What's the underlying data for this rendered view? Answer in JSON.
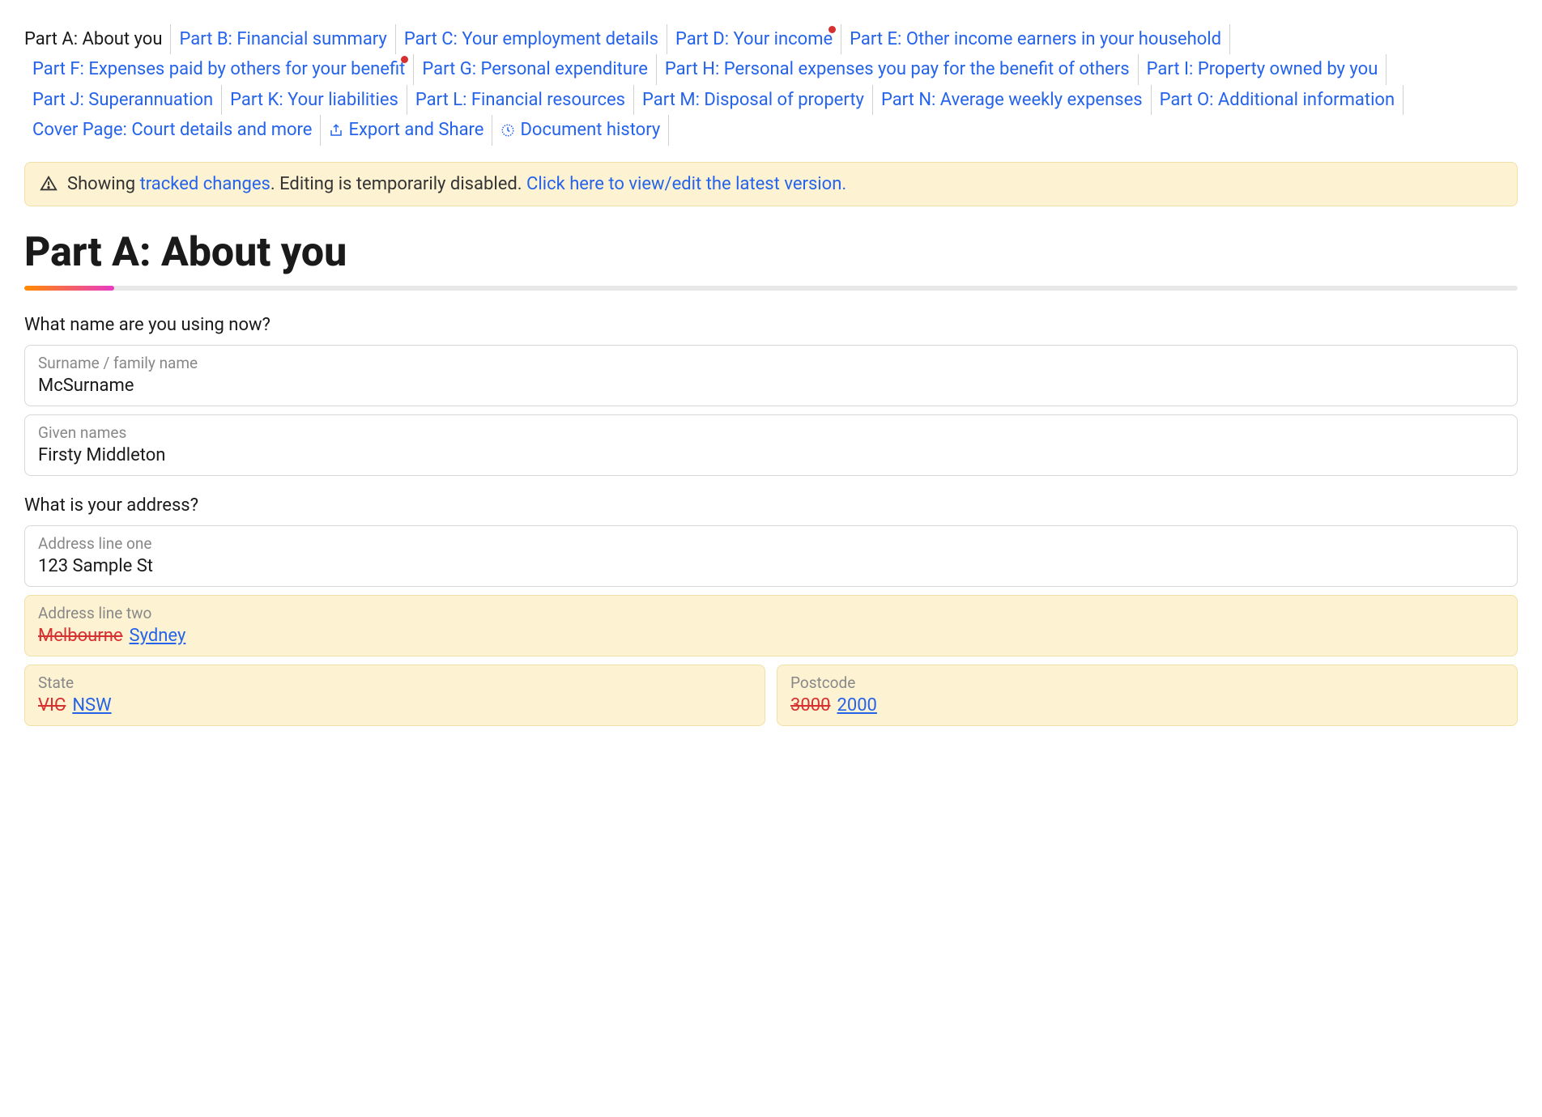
{
  "nav": [
    {
      "label": "Part A: About you",
      "active": true,
      "dot": false
    },
    {
      "label": "Part B: Financial summary",
      "active": false,
      "dot": false
    },
    {
      "label": "Part C: Your employment details",
      "active": false,
      "dot": false
    },
    {
      "label": "Part D: Your income",
      "active": false,
      "dot": true
    },
    {
      "label": "Part E: Other income earners in your household",
      "active": false,
      "dot": false
    },
    {
      "label": "Part F: Expenses paid by others for your benefit",
      "active": false,
      "dot": true
    },
    {
      "label": "Part G: Personal expenditure",
      "active": false,
      "dot": false
    },
    {
      "label": "Part H: Personal expenses you pay for the benefit of others",
      "active": false,
      "dot": false
    },
    {
      "label": "Part I: Property owned by you",
      "active": false,
      "dot": false
    },
    {
      "label": "Part J: Superannuation",
      "active": false,
      "dot": false
    },
    {
      "label": "Part K: Your liabilities",
      "active": false,
      "dot": false
    },
    {
      "label": "Part L: Financial resources",
      "active": false,
      "dot": false
    },
    {
      "label": "Part M: Disposal of property",
      "active": false,
      "dot": false
    },
    {
      "label": "Part N: Average weekly expenses",
      "active": false,
      "dot": false
    },
    {
      "label": "Part O: Additional information",
      "active": false,
      "dot": false
    },
    {
      "label": "Cover Page: Court details and more",
      "active": false,
      "dot": false
    },
    {
      "label": "Export and Share",
      "active": false,
      "dot": false,
      "icon": "export"
    },
    {
      "label": "Document history",
      "active": false,
      "dot": false,
      "icon": "clock"
    }
  ],
  "banner": {
    "prefix": "Showing ",
    "tracked_link": "tracked changes",
    "middle": ". Editing is temporarily disabled. ",
    "view_link": "Click here to view/edit the latest version."
  },
  "page_title": "Part A: About you",
  "questions": {
    "name_q": "What name are you using now?",
    "surname_label": "Surname / family name",
    "surname_value": "McSurname",
    "given_label": "Given names",
    "given_value": "Firsty Middleton",
    "address_q": "What is your address?",
    "addr1_label": "Address line one",
    "addr1_value": "123 Sample St",
    "addr2_label": "Address line two",
    "addr2_old": "Melbourne",
    "addr2_new": "Sydney",
    "state_label": "State",
    "state_old": "VIC",
    "state_new": "NSW",
    "postcode_label": "Postcode",
    "postcode_old": "3000",
    "postcode_new": "2000"
  }
}
